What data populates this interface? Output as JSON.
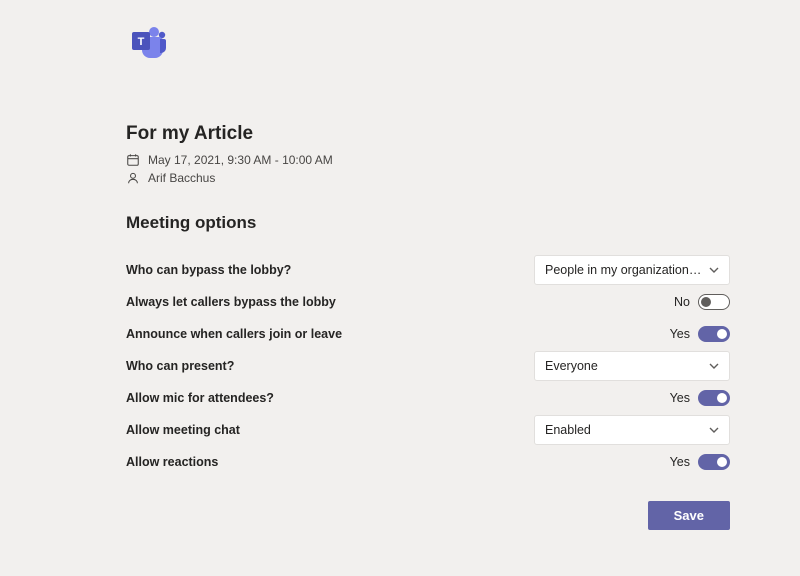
{
  "header": {
    "app": "Microsoft Teams"
  },
  "meeting": {
    "title": "For my Article",
    "datetime": "May 17, 2021, 9:30 AM - 10:00 AM",
    "organizer": "Arif Bacchus"
  },
  "section": {
    "title": "Meeting options"
  },
  "options": {
    "lobby_bypass": {
      "label": "Who can bypass the lobby?",
      "value": "People in my organization and gu..."
    },
    "callers_bypass": {
      "label": "Always let callers bypass the lobby",
      "status": "No"
    },
    "announce": {
      "label": "Announce when callers join or leave",
      "status": "Yes"
    },
    "present": {
      "label": "Who can present?",
      "value": "Everyone"
    },
    "mic": {
      "label": "Allow mic for attendees?",
      "status": "Yes"
    },
    "chat": {
      "label": "Allow meeting chat",
      "value": "Enabled"
    },
    "reactions": {
      "label": "Allow reactions",
      "status": "Yes"
    }
  },
  "footer": {
    "save": "Save"
  },
  "colors": {
    "accent": "#6264a7",
    "bg": "#f2f0ee"
  }
}
